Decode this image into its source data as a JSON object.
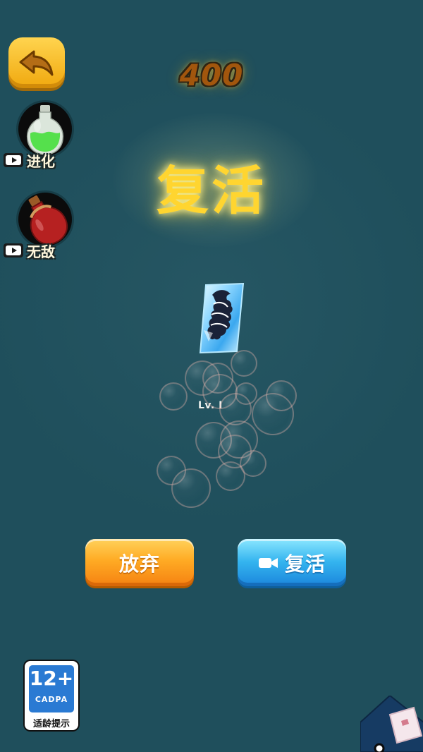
{
  "score": "400",
  "title": "复活",
  "powerups": [
    {
      "label": "进化",
      "icon": "green-potion-icon"
    },
    {
      "label": "无敌",
      "icon": "red-potion-icon"
    }
  ],
  "player": {
    "level": "Lv. I"
  },
  "buttons": {
    "give_up": "放弃",
    "revive": "复活"
  },
  "age_badge": {
    "age": "12+",
    "org": "CADPA",
    "hint": "适龄提示"
  },
  "colors": {
    "background": "#1f4f5c",
    "gold": "#ffd530",
    "orange_button": "#ff9f1a",
    "blue_button": "#2aa8ec"
  }
}
